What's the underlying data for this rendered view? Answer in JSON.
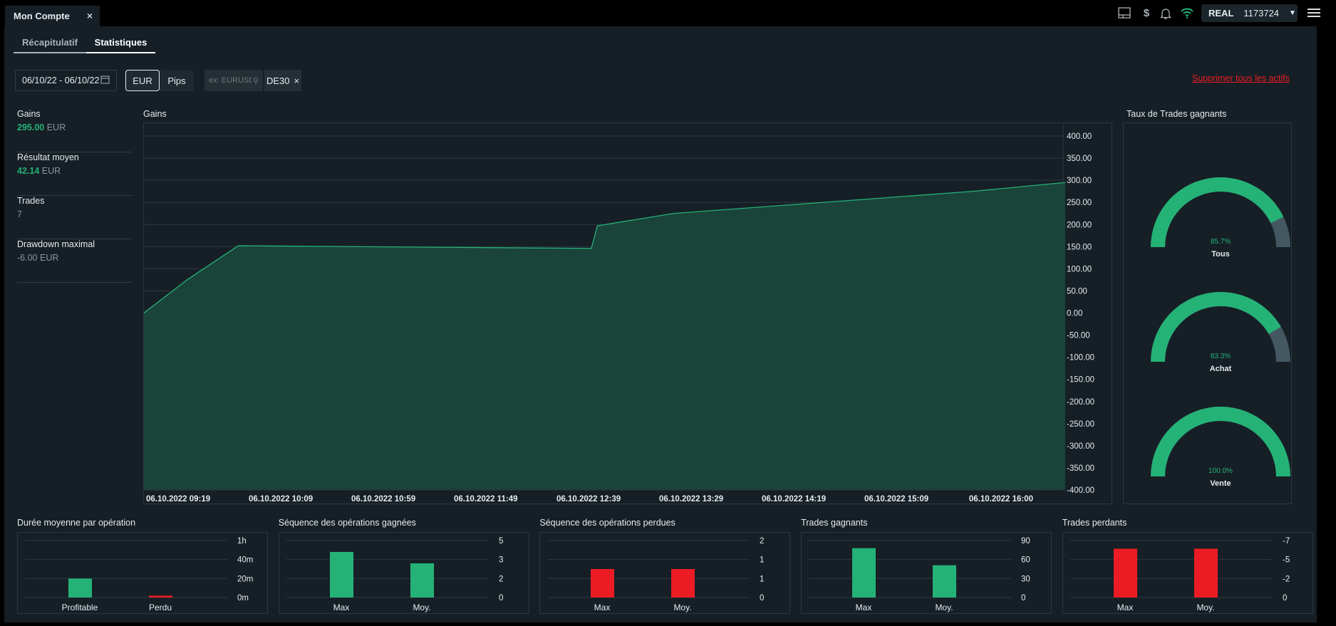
{
  "window_tab": {
    "title": "Mon Compte",
    "close": "×"
  },
  "topbar": {
    "icons": [
      "layout-icon",
      "dollar-signal-icon",
      "bell-icon",
      "wifi-icon"
    ],
    "account_type": "REAL",
    "account_number": "1173724",
    "wifi_color": "#25b277"
  },
  "subtabs": [
    {
      "label": "Récapitulatif",
      "active": false
    },
    {
      "label": "Statistiques",
      "active": true
    }
  ],
  "filters": {
    "date_range": "06/10/22 - 06/10/22",
    "units": [
      "EUR",
      "Pips"
    ],
    "selected_unit": "EUR",
    "search_placeholder": "ex: EURUSD",
    "asset_chip": "DE30",
    "clear_all": "Supprimer tous les actifs"
  },
  "stats": [
    {
      "label": "Gains",
      "value": "295.00",
      "unit": "EUR",
      "positive": true
    },
    {
      "label": "Résultat moyen",
      "value": "42.14",
      "unit": "EUR",
      "positive": true
    },
    {
      "label": "Trades",
      "value": "7",
      "unit": "",
      "positive": false
    },
    {
      "label": "Drawdown maximal",
      "value": "-6.00",
      "unit": "EUR",
      "positive": false
    }
  ],
  "colors": {
    "green": "#25b277",
    "red": "#ec1c24",
    "gauge_rest": "#445862",
    "area": "#1b4a3d"
  },
  "gauges": {
    "title": "Taux de Trades gagnants",
    "items": [
      {
        "label": "Tous",
        "value": 85.7,
        "text": "85.7%"
      },
      {
        "label": "Achat",
        "value": 83.3,
        "text": "83.3%"
      },
      {
        "label": "Vente",
        "value": 100,
        "text": "100.0%"
      }
    ]
  },
  "chart_data": [
    {
      "type": "area",
      "title": "Gains",
      "x": [
        "06.10.2022 09:19",
        "06.10.2022 09:40",
        "06.10.2022 10:05",
        "06.10.2022 12:57",
        "06.10.2022 13:00",
        "06.10.2022 13:37",
        "06.10.2022 16:03",
        "06.10.2022 16:48"
      ],
      "y": [
        0,
        75,
        152,
        146,
        197,
        225,
        275,
        295
      ],
      "xticks": [
        "06.10.2022 09:19",
        "06.10.2022 10:09",
        "06.10.2022 10:59",
        "06.10.2022 11:49",
        "06.10.2022 12:39",
        "06.10.2022 13:29",
        "06.10.2022 14:19",
        "06.10.2022 15:09",
        "06.10.2022 16:00"
      ],
      "yticks": [
        "400.00",
        "350.00",
        "300.00",
        "250.00",
        "200.00",
        "150.00",
        "100.00",
        "50.00",
        "0.00",
        "-50.00",
        "-100.00",
        "-150.00",
        "-200.00",
        "-250.00",
        "-300.00",
        "-350.00",
        "-400.00"
      ],
      "ylim": [
        -400,
        400
      ],
      "grid": true
    },
    {
      "type": "bar",
      "title": "Durée moyenne par opération",
      "categories": [
        "Profitable",
        "Perdu"
      ],
      "values": [
        20,
        2
      ],
      "unit": "minutes",
      "colors": [
        "#25b277",
        "#ec1c24"
      ],
      "yticks": [
        "1h",
        "40m",
        "20m",
        "0m"
      ],
      "ylim": [
        0,
        60
      ]
    },
    {
      "type": "bar",
      "title": "Séquence des opérations gagnées",
      "categories": [
        "Max",
        "Moy."
      ],
      "values": [
        4,
        3
      ],
      "colors": [
        "#25b277",
        "#25b277"
      ],
      "yticks": [
        "5",
        "3",
        "2",
        "0"
      ],
      "ylim": [
        0,
        5
      ]
    },
    {
      "type": "bar",
      "title": "Séquence des opérations perdues",
      "categories": [
        "Max",
        "Moy."
      ],
      "values": [
        1,
        1
      ],
      "colors": [
        "#ec1c24",
        "#ec1c24"
      ],
      "yticks": [
        "2",
        "1",
        "1",
        "0"
      ],
      "ylim": [
        0,
        2
      ]
    },
    {
      "type": "bar",
      "title": "Trades gagnants",
      "categories": [
        "Max",
        "Moy."
      ],
      "values": [
        78,
        51
      ],
      "colors": [
        "#25b277",
        "#25b277"
      ],
      "yticks": [
        "90",
        "60",
        "30",
        "0"
      ],
      "ylim": [
        0,
        90
      ]
    },
    {
      "type": "bar",
      "title": "Trades perdants",
      "categories": [
        "Max",
        "Moy."
      ],
      "values": [
        -6,
        -6
      ],
      "colors": [
        "#ec1c24",
        "#ec1c24"
      ],
      "yticks": [
        "-7",
        "-5",
        "-2",
        "0"
      ],
      "ylim": [
        0,
        -7
      ]
    }
  ]
}
